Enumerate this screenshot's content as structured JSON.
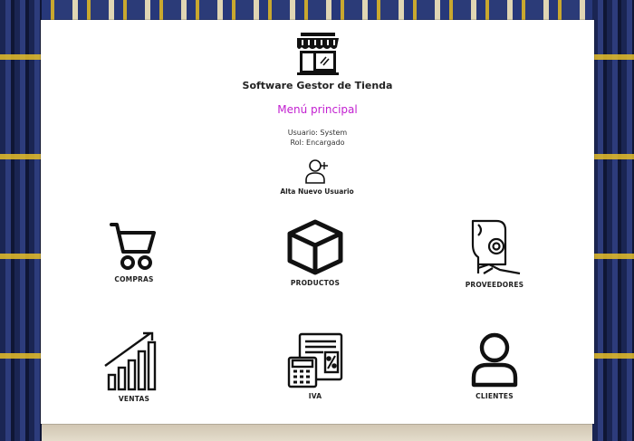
{
  "app": {
    "title": "Software Gestor de Tienda",
    "menu_title": "Menú principal",
    "user_line": "Usuario: System",
    "role_line": "Rol: Encargado"
  },
  "actions": {
    "add_user_label": "Alta Nuevo Usuario"
  },
  "modules": [
    {
      "label": "COMPRAS",
      "icon": "shopping-cart-icon"
    },
    {
      "label": "PRODUCTOS",
      "icon": "box-icon"
    },
    {
      "label": "PROVEEDORES",
      "icon": "supplier-icon"
    },
    {
      "label": "VENTAS",
      "icon": "growth-chart-icon"
    },
    {
      "label": "IVA",
      "icon": "calculator-icon"
    },
    {
      "label": "CLIENTES",
      "icon": "user-icon"
    }
  ],
  "colors": {
    "menu_title": "#c21fd0",
    "panel_bg": "#ffffff",
    "icon": "#111111"
  }
}
